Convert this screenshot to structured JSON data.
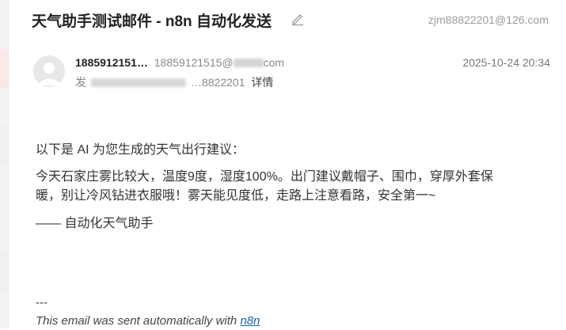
{
  "header": {
    "subject": "天气助手测试邮件 - n8n 自动化发送",
    "account": "zjm88822201@126.com"
  },
  "sender": {
    "name": "1885912151…",
    "email_prefix": "18859121515@",
    "email_suffix": "com",
    "recipient_label": "发",
    "recipient_value": "…8822201",
    "details_label": "详情",
    "timestamp": "2025-10-24 20:34"
  },
  "body": {
    "intro": "以下是 AI 为您生成的天气出行建议：",
    "main": "今天石家庄雾比较大，温度9度，湿度100%。出门建议戴帽子、围巾，穿厚外套保暖，别让冷风钻进衣服哦！雾天能见度低，走路上注意看路，安全第一~",
    "signature": "—— 自动化天气助手"
  },
  "footer": {
    "separator": "---",
    "note": "This email was sent automatically with",
    "link_text": "n8n"
  },
  "icons": {
    "edit": "pencil-icon",
    "avatar": "user-avatar-icon"
  }
}
